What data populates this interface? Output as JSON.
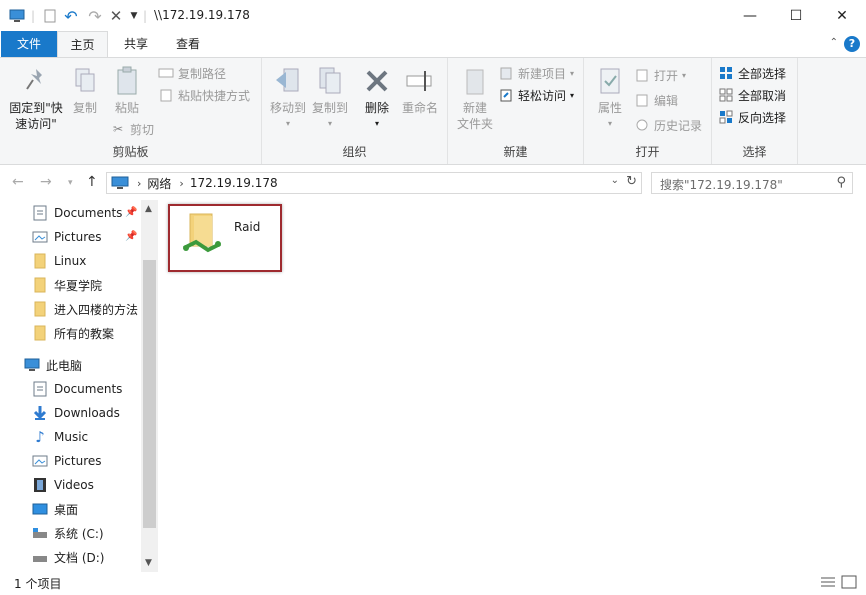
{
  "window": {
    "path": "\\\\172.19.19.178"
  },
  "tabs": {
    "file": "文件",
    "home": "主页",
    "share": "共享",
    "view": "查看"
  },
  "ribbon": {
    "clipboard": {
      "title": "剪贴板",
      "pin_quick_line1": "固定到\"快",
      "pin_quick_line2": "速访问\"",
      "copy": "复制",
      "paste": "粘贴",
      "copy_path": "复制路径",
      "paste_shortcut": "粘贴快捷方式",
      "cut": "剪切"
    },
    "organize": {
      "title": "组织",
      "move_to": "移动到",
      "copy_to": "复制到",
      "delete": "删除",
      "rename": "重命名"
    },
    "new": {
      "title": "新建",
      "new_folder_line1": "新建",
      "new_folder_line2": "文件夹",
      "new_item": "新建项目",
      "easy_access": "轻松访问"
    },
    "open": {
      "title": "打开",
      "properties": "属性",
      "open": "打开",
      "edit": "编辑",
      "history": "历史记录"
    },
    "select": {
      "title": "选择",
      "select_all": "全部选择",
      "select_none": "全部取消",
      "invert": "反向选择"
    }
  },
  "address": {
    "crumbs": [
      "网络",
      "172.19.19.178"
    ]
  },
  "search": {
    "placeholder": "搜索\"172.19.19.178\""
  },
  "nav": {
    "quick": [
      "Documents",
      "Pictures",
      "Linux",
      "华夏学院",
      "进入四楼的方法",
      "所有的教案"
    ],
    "this_pc": "此电脑",
    "pc": [
      "Documents",
      "Downloads",
      "Music",
      "Pictures",
      "Videos",
      "桌面",
      "系统 (C:)",
      "文档 (D:)"
    ]
  },
  "content": {
    "items": [
      {
        "name": "Raid"
      }
    ]
  },
  "status": {
    "count": "1 个项目"
  },
  "colors": {
    "accent": "#1979ca",
    "folder": "#f3d27a",
    "highlight_border": "#9e2a2f"
  }
}
